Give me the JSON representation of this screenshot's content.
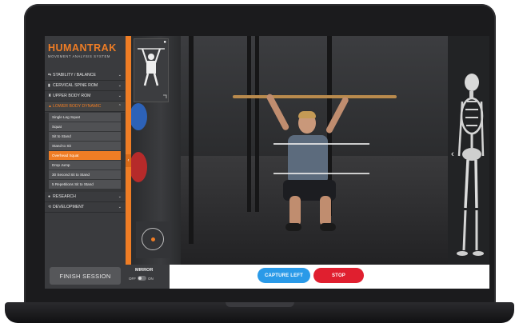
{
  "app": {
    "logo_main": "HUMANTRAK",
    "logo_sub": "MOVEMENT ANALYSIS SYSTEM"
  },
  "sidebar": {
    "items": [
      {
        "label": "STABILITY / BALANCE",
        "icon": "balance-icon"
      },
      {
        "label": "CERVICAL SPINE ROM",
        "icon": "spine-icon"
      },
      {
        "label": "UPPER BODY ROM",
        "icon": "upper-body-icon"
      },
      {
        "label": "LOWER BODY DYNAMIC",
        "icon": "lower-body-icon"
      }
    ],
    "sub_items": [
      {
        "label": "Single Leg Squat"
      },
      {
        "label": "Squat"
      },
      {
        "label": "Sit to Stand"
      },
      {
        "label": "Stand to Sit"
      },
      {
        "label": "Overhead Squat"
      },
      {
        "label": "Drop Jump"
      },
      {
        "label": "30 Second Sit to Stand"
      },
      {
        "label": "5 Repetitions Sit to Stand"
      }
    ],
    "selected_sub_item": "Overhead Squat",
    "more_items": [
      {
        "label": "RESEARCH",
        "icon": "research-icon"
      },
      {
        "label": "DEVELOPMENT",
        "icon": "development-icon"
      }
    ],
    "finish_label": "FINISH SESSION"
  },
  "controls": {
    "mirror_label": "MIRROR",
    "mirror_off": "OFF",
    "mirror_on": "ON",
    "capture_label": "CAPTURE LEFT",
    "stop_label": "STOP"
  },
  "colors": {
    "accent": "#ef7d25",
    "capture": "#2a9ae8",
    "stop": "#e01f2f"
  }
}
